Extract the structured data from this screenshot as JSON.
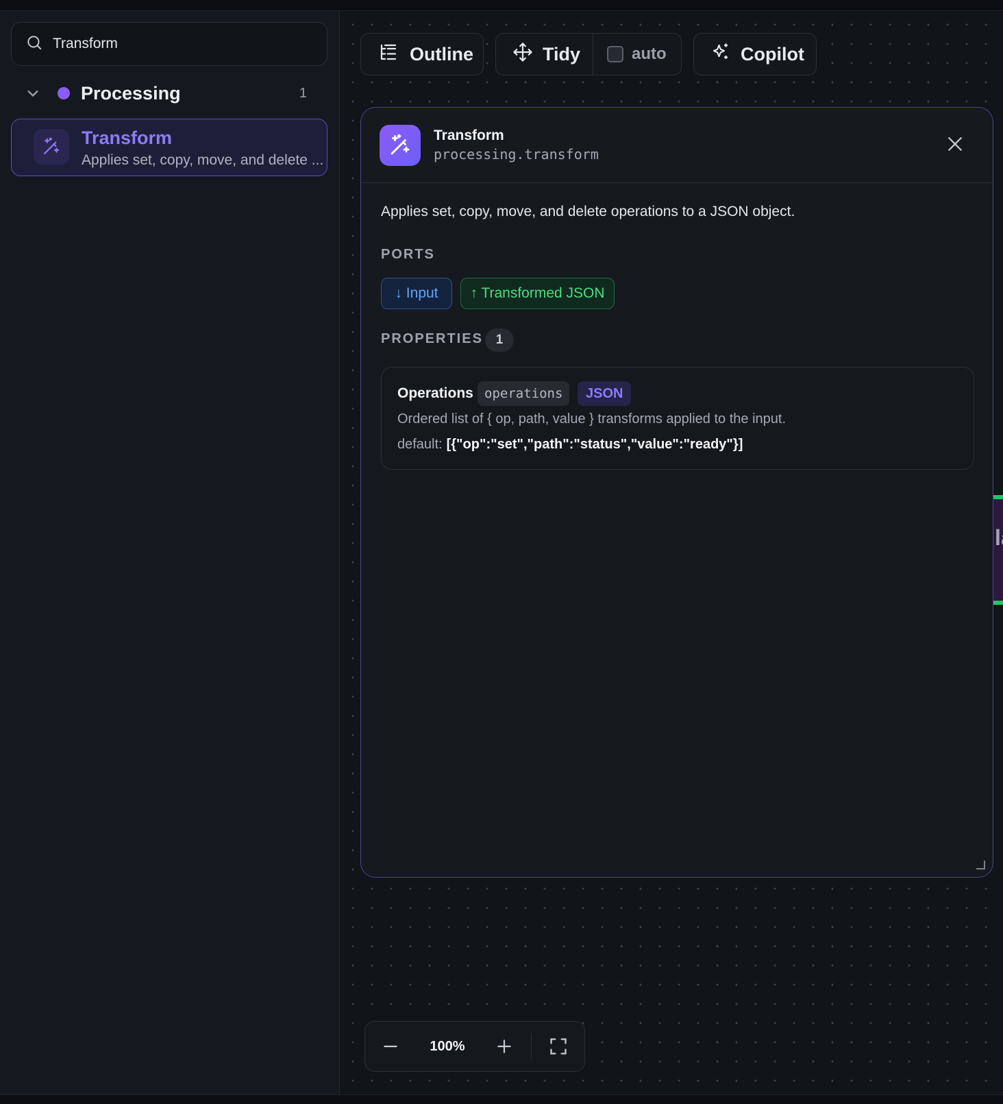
{
  "sidebar": {
    "search": {
      "value": "Transform",
      "icon": "search-icon"
    },
    "group": {
      "label": "Processing",
      "count": "1",
      "dot_color": "#8b5cf6"
    },
    "items": [
      {
        "title": "Transform",
        "description": "Applies set, copy, move, and delete ...",
        "icon": "magic-wand-icon"
      }
    ]
  },
  "toolbar": {
    "outline_label": "Outline",
    "tidy_label": "Tidy",
    "auto_label": "auto",
    "copilot_label": "Copilot"
  },
  "detail": {
    "title": "Transform",
    "subtitle": "processing.transform",
    "description": "Applies set, copy, move, and delete operations to a JSON object.",
    "ports_heading": "PORTS",
    "ports": {
      "input": "↓ Input",
      "output": "↑ Transformed JSON"
    },
    "properties_heading": "PROPERTIES",
    "properties_count": "1",
    "properties": [
      {
        "name": "Operations",
        "key": "operations",
        "type": "JSON",
        "description": "Ordered list of { op, path, value } transforms applied to the input.",
        "default_label": "default:",
        "default_value": "[{\"op\":\"set\",\"path\":\"status\",\"value\":\"ready\"}]"
      }
    ]
  },
  "canvas": {
    "peek_text": "la"
  },
  "zoom": {
    "value": "100%"
  },
  "colors": {
    "accent": "#8b5cf6",
    "input_port": "#60a5fa",
    "output_port": "#4ade80"
  }
}
